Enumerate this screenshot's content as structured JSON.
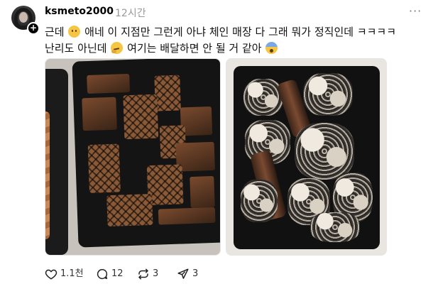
{
  "post": {
    "username": "ksmeto2000",
    "timestamp": "12시간",
    "text_line1_a": "근데",
    "text_line1_b": "애네 이 지점만 그런게 아냐 체인 매장 다 그래 뭐가 정직인데 ㅋㅋㅋㅋ",
    "text_line2_a": "난리도 아닌데",
    "text_line2_b": "여기는 배달하면 안 될 거 같아",
    "follow_badge": "+",
    "more_icon": "···"
  },
  "actions": {
    "like_count": "1.1천",
    "comment_count": "12",
    "repost_count": "3",
    "share_count": "3"
  },
  "icons": {
    "like": "heart-icon",
    "comment": "comment-icon",
    "repost": "repost-icon",
    "share": "send-icon"
  }
}
